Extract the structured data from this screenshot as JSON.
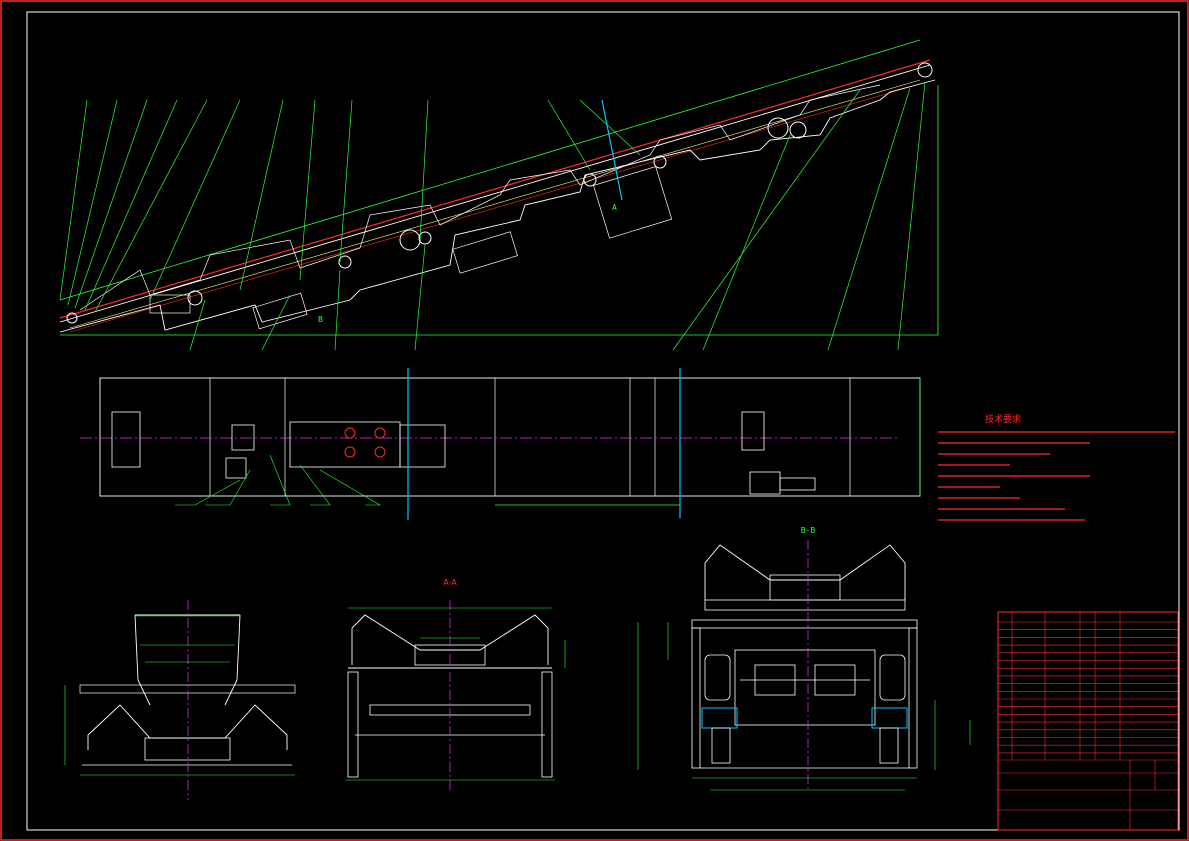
{
  "drawing": {
    "elevation_labels": {
      "section_a": "A",
      "section_b": "B"
    },
    "plan_title": "",
    "notes_heading": "技术要求",
    "section_aa_title": "A-A",
    "section_bb_title": "B-B",
    "left_section_title": ""
  },
  "colors": {
    "frame": "#ff2a2a",
    "outline": "#ffffff",
    "dimension": "#27ff3a",
    "centerline": "#ff2aff",
    "marker": "#00c8ff",
    "text": "#ff2a2a"
  }
}
